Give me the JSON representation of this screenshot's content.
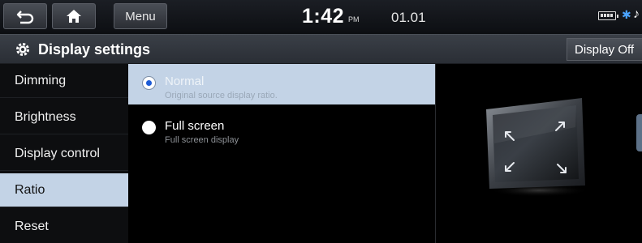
{
  "status_bar": {
    "menu_label": "Menu",
    "time": "1:42",
    "ampm": "PM",
    "date": "01.01",
    "icons": [
      "back-icon",
      "home-icon",
      "battery-icon",
      "bluetooth-icon",
      "music-note-icon"
    ]
  },
  "header": {
    "title": "Display settings",
    "display_off_label": "Display Off"
  },
  "sidebar": {
    "items": [
      {
        "label": "Dimming"
      },
      {
        "label": "Brightness"
      },
      {
        "label": "Display control"
      },
      {
        "label": "Ratio",
        "active": true
      },
      {
        "label": "Reset"
      }
    ]
  },
  "options": [
    {
      "label": "Normal",
      "description": "Original source display ratio.",
      "selected": true
    },
    {
      "label": "Full screen",
      "description": "Full screen display",
      "selected": false
    }
  ],
  "colors": {
    "accent": "#c3d3e6",
    "radio_dot": "#1d5bd6"
  }
}
